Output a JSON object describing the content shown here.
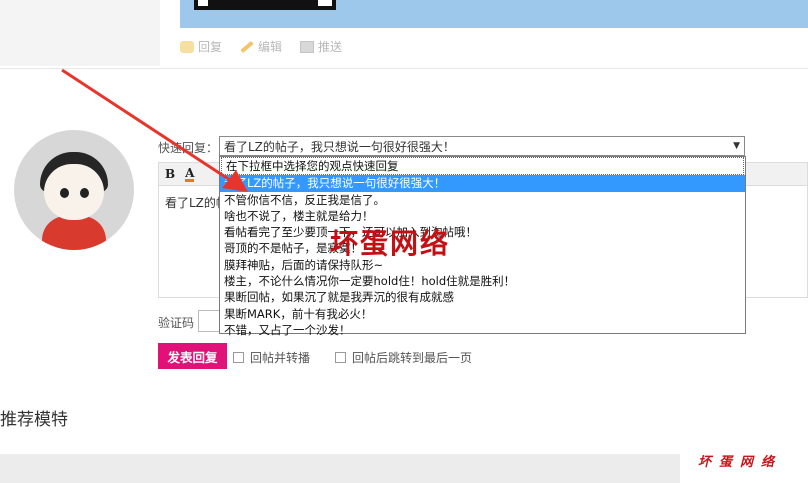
{
  "post_actions": [
    {
      "label": "回复",
      "icon": "reply-icon"
    },
    {
      "label": "编辑",
      "icon": "edit-icon"
    },
    {
      "label": "推送",
      "icon": "push-icon"
    }
  ],
  "quick_reply": {
    "label": "快速回复：",
    "selected": "看了LZ的帖子，我只想说一句很好很强大！",
    "options": [
      "在下拉框中选择您的观点快速回复",
      "看了LZ的帖子，我只想说一句很好很强大！",
      "不管你信不信，反正我是信了。",
      "啥也不说了，楼主就是给力！",
      "看帖看完了至少要顶一下，还可以加入到淘帖哦！",
      "哥顶的不是帖子，是寂寞！",
      "膜拜神贴，后面的请保持队形~",
      "楼主，不论什么情况你一定要hold住！hold住就是胜利！",
      "果断回帖，如果沉了就是我弄沉的很有成就感",
      "果断MARK，前十有我必火！",
      "不错，又占了一个沙发！"
    ]
  },
  "editor": {
    "toolbar": [
      "B",
      "A"
    ],
    "content": "看了LZ的帖"
  },
  "captcha_label": "验证码",
  "submit_label": "发表回复",
  "checkboxes": [
    "回帖并转播",
    "回帖后跳转到最后一页"
  ],
  "recommend_title": "推荐模特",
  "watermark": {
    "big": "坏蛋网络",
    "small": "坏蛋网络"
  },
  "colors": {
    "accent": "#e0127a",
    "selection": "#3399ff",
    "watermark": "#c41014",
    "arrow": "#e8352b"
  }
}
